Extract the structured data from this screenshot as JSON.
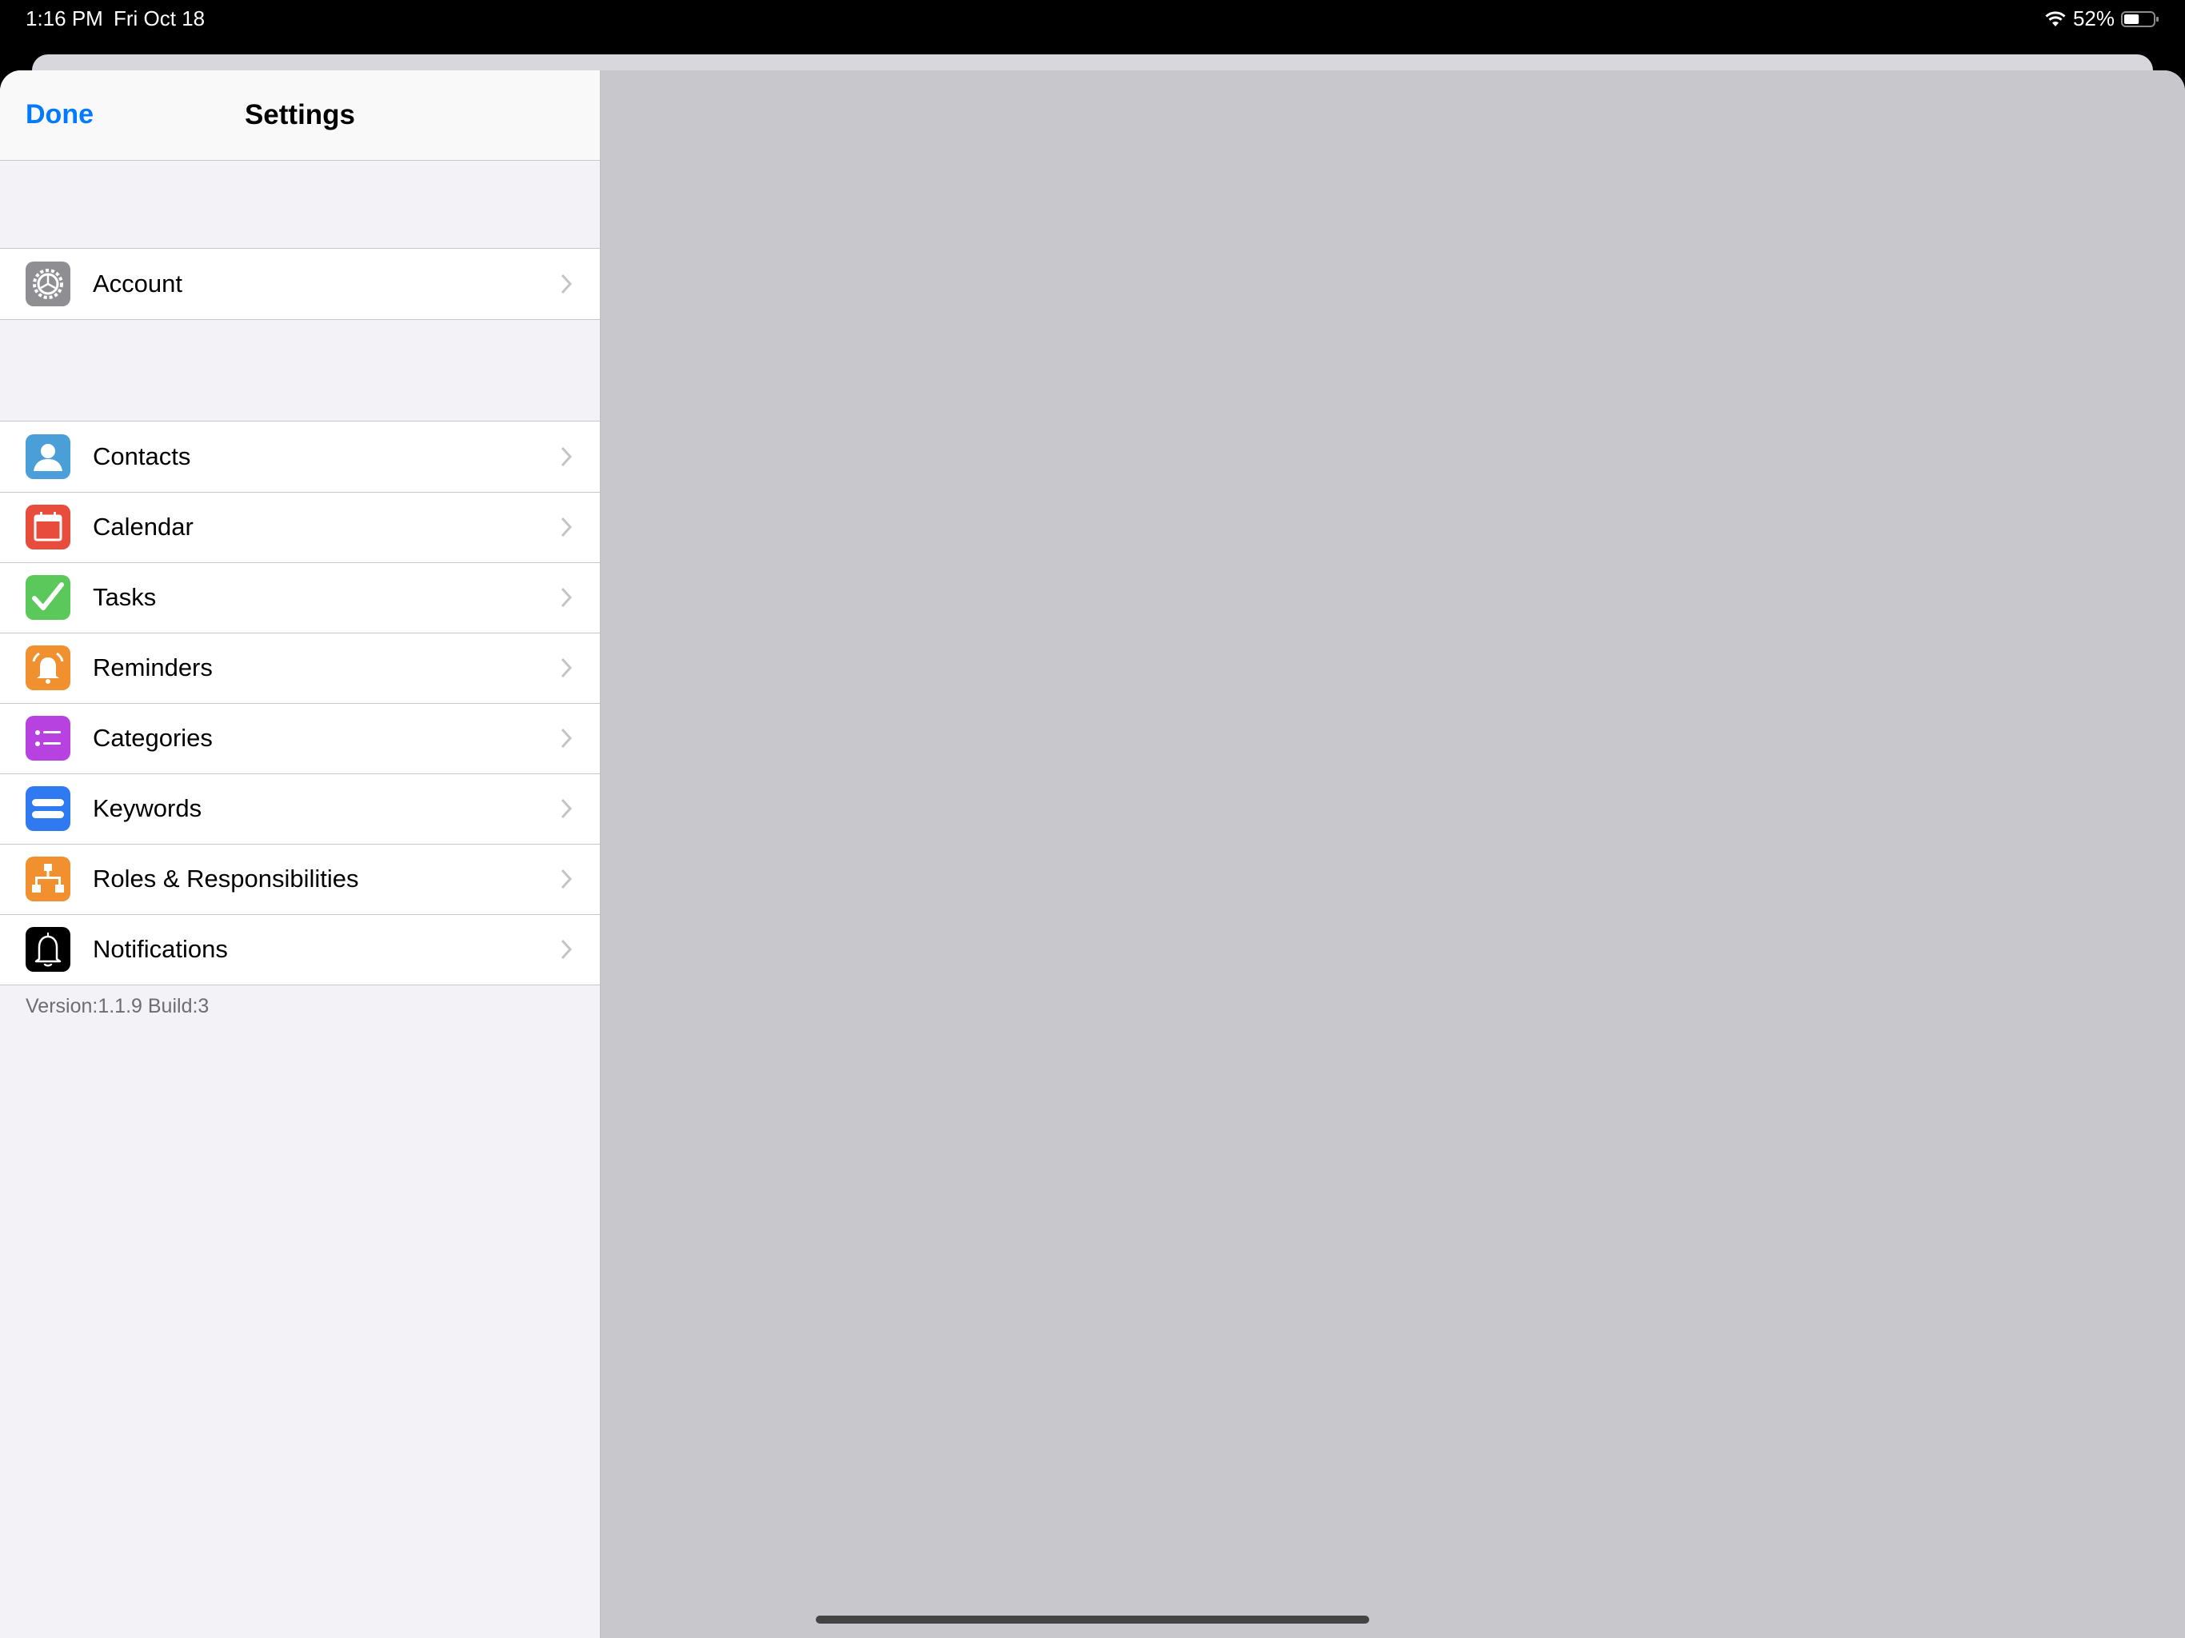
{
  "status_bar": {
    "time": "1:16 PM",
    "date": "Fri Oct 18",
    "battery_percent": "52%",
    "battery_level": 0.52
  },
  "nav": {
    "done_label": "Done",
    "title": "Settings"
  },
  "groups": [
    {
      "items": [
        {
          "label": "Account",
          "icon": "gear-icon",
          "color": "#8e8e93"
        }
      ]
    },
    {
      "items": [
        {
          "label": "Contacts",
          "icon": "contact-icon",
          "color": "#4a9fd8"
        },
        {
          "label": "Calendar",
          "icon": "calendar-icon",
          "color": "#e74c3c"
        },
        {
          "label": "Tasks",
          "icon": "checkmark-icon",
          "color": "#5ac85a"
        },
        {
          "label": "Reminders",
          "icon": "bell-alarm-icon",
          "color": "#f0902e"
        },
        {
          "label": "Categories",
          "icon": "list-icon",
          "color": "#b842e0"
        },
        {
          "label": "Keywords",
          "icon": "keyword-icon",
          "color": "#2f7af0"
        },
        {
          "label": "Roles & Responsibilities",
          "icon": "hierarchy-icon",
          "color": "#f0902e"
        },
        {
          "label": "Notifications",
          "icon": "bell-icon",
          "color": "#000000"
        }
      ]
    }
  ],
  "footer": {
    "version_text": "Version:1.1.9  Build:3"
  },
  "colors": {
    "accent": "#007aff",
    "master_bg": "#f2f2f7",
    "detail_bg": "#c7c7cc"
  }
}
